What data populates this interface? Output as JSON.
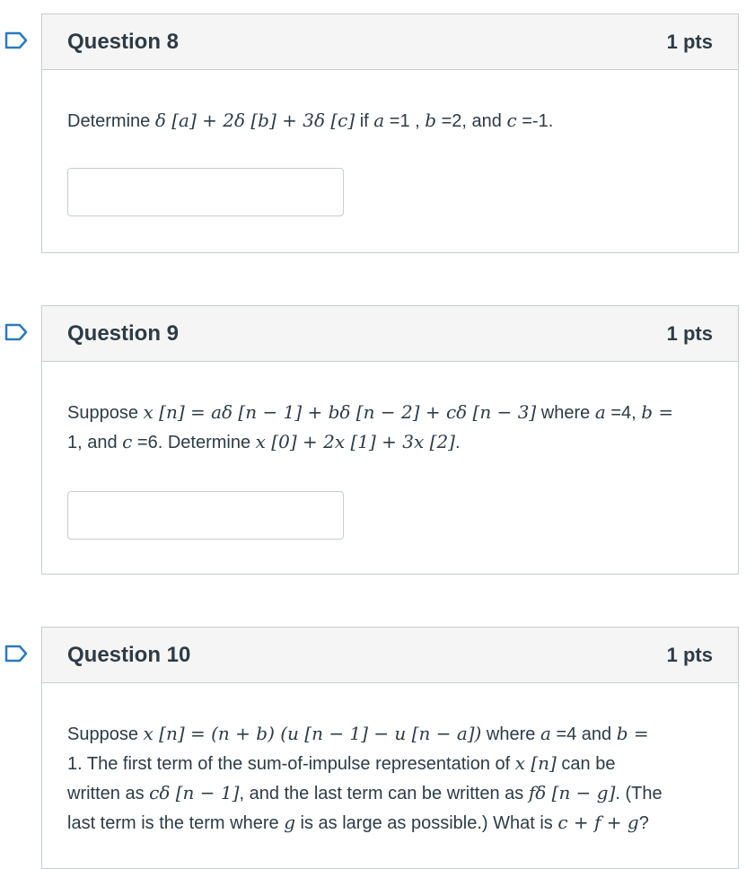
{
  "questions": [
    {
      "title": "Question 8",
      "points": "1 pts",
      "text_parts": [
        "Determine ",
        "δ [a] + 2δ [b] + 3δ [c]",
        " if ",
        "a",
        " =1 , ",
        "b",
        " =2, and ",
        "c",
        " =-1."
      ]
    },
    {
      "title": "Question 9",
      "points": "1 pts",
      "line1": [
        "Suppose ",
        "x [n] = aδ [n − 1] + bδ [n − 2] + cδ [n − 3]",
        " where ",
        "a",
        " =4, ",
        "b",
        " ="
      ],
      "line2": [
        "1, and ",
        "c",
        " =6. Determine ",
        "x [0] + 2x [1] + 3x [2]",
        "."
      ]
    },
    {
      "title": "Question 10",
      "points": "1 pts",
      "line1": [
        "Suppose ",
        "x [n] = (n + b) (u [n − 1] − u [n − a])",
        " where ",
        "a",
        " =4 and ",
        "b",
        " ="
      ],
      "line2": [
        "1. The first term of the sum-of-impulse representation of ",
        "x [n]",
        " can be"
      ],
      "line3": [
        "written as ",
        "cδ [n − 1]",
        ", and the last term can be written as ",
        "fδ [n − g]",
        ". (The"
      ],
      "line4": [
        "last term is the term where ",
        "g",
        " is as large as possible.) What is ",
        "c + f + g",
        "?"
      ]
    }
  ]
}
